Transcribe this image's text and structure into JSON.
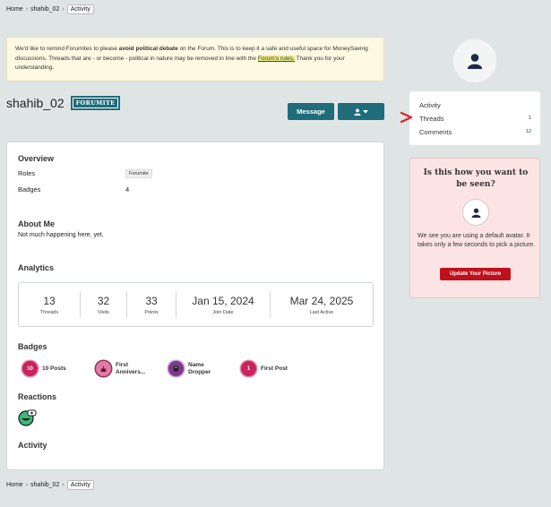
{
  "breadcrumb": {
    "home": "Home",
    "sep": "›",
    "user": "shahib_02",
    "current": "Activity"
  },
  "notice": {
    "text_pre": "We'd like to remind Forumites to please ",
    "text_bold": "avoid political debate",
    "text_mid": " on the Forum. This is to keep it a safe and useful space for MoneySaving discussions. Threads that are - or become - political in nature may be removed in line with the ",
    "link": "Forum's rules.",
    "text_post": " Thank you for your understanding."
  },
  "profile": {
    "username": "shahib_02",
    "role_badge": "FORUMITE",
    "message_button": "Message",
    "user_menu_icon": "user-icon"
  },
  "overview": {
    "heading": "Overview",
    "roles_label": "Roles",
    "roles_value": "Forumite",
    "badges_label": "Badges",
    "badges_value": "4"
  },
  "about": {
    "heading": "About Me",
    "text": "Not much happening here, yet."
  },
  "analytics": {
    "heading": "Analytics",
    "stats": [
      {
        "value": "13",
        "label": "Threads"
      },
      {
        "value": "32",
        "label": "Visits"
      },
      {
        "value": "33",
        "label": "Points"
      },
      {
        "value": "Jan 15, 2024",
        "label": "Join Date"
      },
      {
        "value": "Mar 24, 2025",
        "label": "Last Active"
      }
    ]
  },
  "badges": {
    "heading": "Badges",
    "items": [
      {
        "icon_text": "10",
        "label1": "10 Posts",
        "label2": "",
        "color": "#c8235a",
        "ring": "#e38aa8"
      },
      {
        "icon_text": "",
        "label1": "First",
        "label2": "Annivers...",
        "color": "#e37aa8",
        "ring": "#8a3a5a",
        "icon": "cake-icon"
      },
      {
        "icon_text": "",
        "label1": "Name",
        "label2": "Dropper",
        "color": "#7a3a8a",
        "ring": "#c89ad6",
        "icon": "name-tag-icon"
      },
      {
        "icon_text": "1",
        "label1": "First Post",
        "label2": "",
        "color": "#c8235a",
        "ring": "#e38aa8"
      }
    ]
  },
  "reactions": {
    "heading": "Reactions",
    "icon": "reaction-icon"
  },
  "activity": {
    "heading": "Activity"
  },
  "sidebar": {
    "menu": [
      {
        "label": "Activity",
        "count": ""
      },
      {
        "label": "Threads",
        "count": "1"
      },
      {
        "label": "Comments",
        "count": "12"
      }
    ],
    "cta": {
      "title": "Is this how you want to be seen?",
      "text": "We see you are using a default avatar. It takes only a few seconds to pick a picture.",
      "button": "Update Your Picture"
    }
  },
  "colors": {
    "accent": "#1f6c7a",
    "cta_bg": "#fbe4e3",
    "cta_button": "#c0101b",
    "arrow": "#e0202a"
  }
}
